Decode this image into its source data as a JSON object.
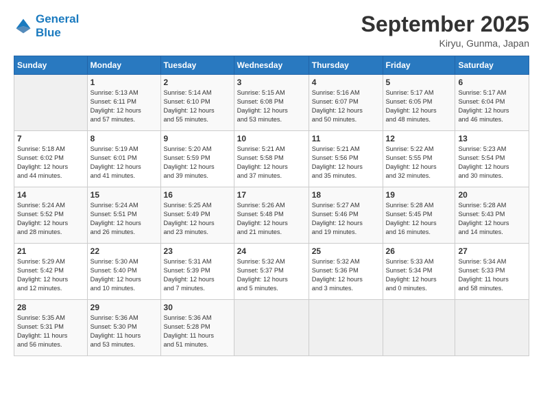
{
  "header": {
    "logo_line1": "General",
    "logo_line2": "Blue",
    "month": "September 2025",
    "location": "Kiryu, Gunma, Japan"
  },
  "days_of_week": [
    "Sunday",
    "Monday",
    "Tuesday",
    "Wednesday",
    "Thursday",
    "Friday",
    "Saturday"
  ],
  "weeks": [
    [
      {
        "day": "",
        "info": ""
      },
      {
        "day": "1",
        "info": "Sunrise: 5:13 AM\nSunset: 6:11 PM\nDaylight: 12 hours\nand 57 minutes."
      },
      {
        "day": "2",
        "info": "Sunrise: 5:14 AM\nSunset: 6:10 PM\nDaylight: 12 hours\nand 55 minutes."
      },
      {
        "day": "3",
        "info": "Sunrise: 5:15 AM\nSunset: 6:08 PM\nDaylight: 12 hours\nand 53 minutes."
      },
      {
        "day": "4",
        "info": "Sunrise: 5:16 AM\nSunset: 6:07 PM\nDaylight: 12 hours\nand 50 minutes."
      },
      {
        "day": "5",
        "info": "Sunrise: 5:17 AM\nSunset: 6:05 PM\nDaylight: 12 hours\nand 48 minutes."
      },
      {
        "day": "6",
        "info": "Sunrise: 5:17 AM\nSunset: 6:04 PM\nDaylight: 12 hours\nand 46 minutes."
      }
    ],
    [
      {
        "day": "7",
        "info": "Sunrise: 5:18 AM\nSunset: 6:02 PM\nDaylight: 12 hours\nand 44 minutes."
      },
      {
        "day": "8",
        "info": "Sunrise: 5:19 AM\nSunset: 6:01 PM\nDaylight: 12 hours\nand 41 minutes."
      },
      {
        "day": "9",
        "info": "Sunrise: 5:20 AM\nSunset: 5:59 PM\nDaylight: 12 hours\nand 39 minutes."
      },
      {
        "day": "10",
        "info": "Sunrise: 5:21 AM\nSunset: 5:58 PM\nDaylight: 12 hours\nand 37 minutes."
      },
      {
        "day": "11",
        "info": "Sunrise: 5:21 AM\nSunset: 5:56 PM\nDaylight: 12 hours\nand 35 minutes."
      },
      {
        "day": "12",
        "info": "Sunrise: 5:22 AM\nSunset: 5:55 PM\nDaylight: 12 hours\nand 32 minutes."
      },
      {
        "day": "13",
        "info": "Sunrise: 5:23 AM\nSunset: 5:54 PM\nDaylight: 12 hours\nand 30 minutes."
      }
    ],
    [
      {
        "day": "14",
        "info": "Sunrise: 5:24 AM\nSunset: 5:52 PM\nDaylight: 12 hours\nand 28 minutes."
      },
      {
        "day": "15",
        "info": "Sunrise: 5:24 AM\nSunset: 5:51 PM\nDaylight: 12 hours\nand 26 minutes."
      },
      {
        "day": "16",
        "info": "Sunrise: 5:25 AM\nSunset: 5:49 PM\nDaylight: 12 hours\nand 23 minutes."
      },
      {
        "day": "17",
        "info": "Sunrise: 5:26 AM\nSunset: 5:48 PM\nDaylight: 12 hours\nand 21 minutes."
      },
      {
        "day": "18",
        "info": "Sunrise: 5:27 AM\nSunset: 5:46 PM\nDaylight: 12 hours\nand 19 minutes."
      },
      {
        "day": "19",
        "info": "Sunrise: 5:28 AM\nSunset: 5:45 PM\nDaylight: 12 hours\nand 16 minutes."
      },
      {
        "day": "20",
        "info": "Sunrise: 5:28 AM\nSunset: 5:43 PM\nDaylight: 12 hours\nand 14 minutes."
      }
    ],
    [
      {
        "day": "21",
        "info": "Sunrise: 5:29 AM\nSunset: 5:42 PM\nDaylight: 12 hours\nand 12 minutes."
      },
      {
        "day": "22",
        "info": "Sunrise: 5:30 AM\nSunset: 5:40 PM\nDaylight: 12 hours\nand 10 minutes."
      },
      {
        "day": "23",
        "info": "Sunrise: 5:31 AM\nSunset: 5:39 PM\nDaylight: 12 hours\nand 7 minutes."
      },
      {
        "day": "24",
        "info": "Sunrise: 5:32 AM\nSunset: 5:37 PM\nDaylight: 12 hours\nand 5 minutes."
      },
      {
        "day": "25",
        "info": "Sunrise: 5:32 AM\nSunset: 5:36 PM\nDaylight: 12 hours\nand 3 minutes."
      },
      {
        "day": "26",
        "info": "Sunrise: 5:33 AM\nSunset: 5:34 PM\nDaylight: 12 hours\nand 0 minutes."
      },
      {
        "day": "27",
        "info": "Sunrise: 5:34 AM\nSunset: 5:33 PM\nDaylight: 11 hours\nand 58 minutes."
      }
    ],
    [
      {
        "day": "28",
        "info": "Sunrise: 5:35 AM\nSunset: 5:31 PM\nDaylight: 11 hours\nand 56 minutes."
      },
      {
        "day": "29",
        "info": "Sunrise: 5:36 AM\nSunset: 5:30 PM\nDaylight: 11 hours\nand 53 minutes."
      },
      {
        "day": "30",
        "info": "Sunrise: 5:36 AM\nSunset: 5:28 PM\nDaylight: 11 hours\nand 51 minutes."
      },
      {
        "day": "",
        "info": ""
      },
      {
        "day": "",
        "info": ""
      },
      {
        "day": "",
        "info": ""
      },
      {
        "day": "",
        "info": ""
      }
    ]
  ]
}
